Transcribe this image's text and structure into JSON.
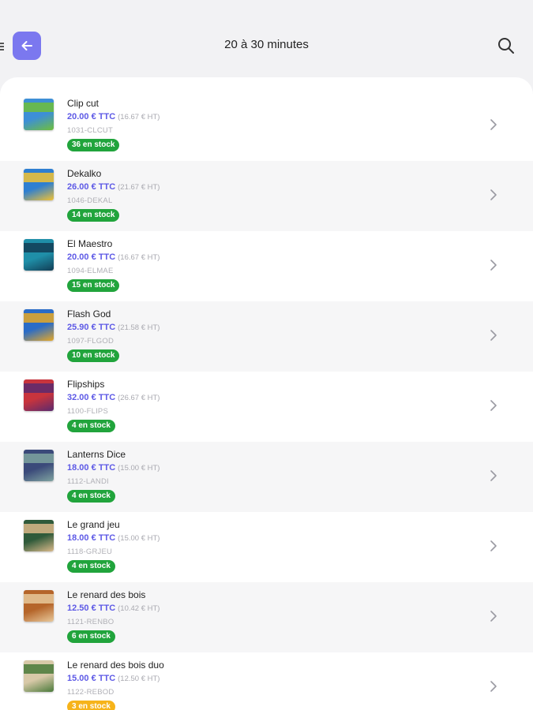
{
  "status_bar": {
    "left_text": "",
    "right_text": ""
  },
  "header": {
    "title": "20 à 30 minutes",
    "back_icon": "arrow-left-icon",
    "search_icon": "search-icon"
  },
  "colors": {
    "accent": "#7b78ef",
    "price": "#5d59e6",
    "stock_green": "#21a43c",
    "stock_orange": "#f6b31a"
  },
  "products": [
    {
      "name": "Clip cut",
      "price": "20.00 € TTC",
      "price_ht": "(16.67 € HT)",
      "sku": "1031-CLCUT",
      "stock": "36 en stock",
      "stock_color": "#21a43c",
      "thumb_colors": [
        "#3d8fd6",
        "#6fbf3a"
      ]
    },
    {
      "name": "Dekalko",
      "price": "26.00 € TTC",
      "price_ht": "(21.67 € HT)",
      "sku": "1046-DEKAL",
      "stock": "14 en stock",
      "stock_color": "#21a43c",
      "thumb_colors": [
        "#2e7fd1",
        "#f2c232"
      ]
    },
    {
      "name": "El Maestro",
      "price": "20.00 € TTC",
      "price_ht": "(16.67 € HT)",
      "sku": "1094-ELMAE",
      "stock": "15 en stock",
      "stock_color": "#21a43c",
      "thumb_colors": [
        "#1f8fa8",
        "#123d55"
      ]
    },
    {
      "name": "Flash God",
      "price": "25.90 € TTC",
      "price_ht": "(21.58 € HT)",
      "sku": "1097-FLGOD",
      "stock": "10 en stock",
      "stock_color": "#21a43c",
      "thumb_colors": [
        "#2a6cc7",
        "#e6a826"
      ]
    },
    {
      "name": "Flipships",
      "price": "32.00 € TTC",
      "price_ht": "(26.67 € HT)",
      "sku": "1100-FLIPS",
      "stock": "4 en stock",
      "stock_color": "#21a43c",
      "thumb_colors": [
        "#c8343d",
        "#5a2a6e"
      ]
    },
    {
      "name": "Lanterns Dice",
      "price": "18.00 € TTC",
      "price_ht": "(15.00 € HT)",
      "sku": "1112-LANDI",
      "stock": "4 en stock",
      "stock_color": "#21a43c",
      "thumb_colors": [
        "#3b4a7a",
        "#7fa3a0"
      ]
    },
    {
      "name": "Le grand jeu",
      "price": "18.00 € TTC",
      "price_ht": "(15.00 € HT)",
      "sku": "1118-GRJEU",
      "stock": "4 en stock",
      "stock_color": "#21a43c",
      "thumb_colors": [
        "#2f5a3a",
        "#d9b98a"
      ]
    },
    {
      "name": "Le renard des bois",
      "price": "12.50 € TTC",
      "price_ht": "(10.42 € HT)",
      "sku": "1121-RENBO",
      "stock": "6 en stock",
      "stock_color": "#21a43c",
      "thumb_colors": [
        "#b5652a",
        "#e8c89a"
      ]
    },
    {
      "name": "Le renard des bois duo",
      "price": "15.00 € TTC",
      "price_ht": "(12.50 € HT)",
      "sku": "1122-REBOD",
      "stock": "3 en stock",
      "stock_color": "#f6b31a",
      "thumb_colors": [
        "#d8c9a8",
        "#4a7a3a"
      ]
    }
  ]
}
